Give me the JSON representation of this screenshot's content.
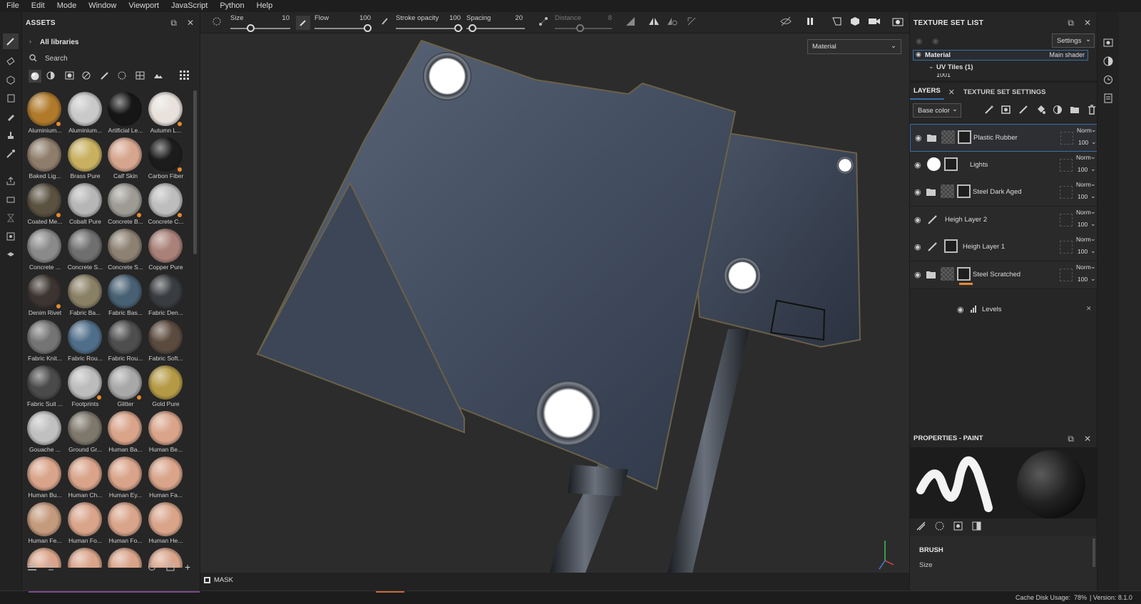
{
  "menu": [
    "File",
    "Edit",
    "Mode",
    "Window",
    "Viewport",
    "JavaScript",
    "Python",
    "Help"
  ],
  "assets": {
    "title": "ASSETS",
    "breadcrumb": "All libraries",
    "search_placeholder": "Search",
    "items": [
      {
        "label": "Aluminium...",
        "color": "#b07a2a",
        "mark": true
      },
      {
        "label": "Aluminium...",
        "color": "#c9c9c9",
        "mark": false
      },
      {
        "label": "Artificial Le...",
        "color": "#161616",
        "mark": false
      },
      {
        "label": "Autumn L...",
        "color": "#e8e1dc",
        "mark": true
      },
      {
        "label": "Baked Lig...",
        "color": "#8e7d6b",
        "mark": false
      },
      {
        "label": "Brass Pure",
        "color": "#c8b060",
        "mark": false
      },
      {
        "label": "Calf Skin",
        "color": "#d6a58e",
        "mark": false
      },
      {
        "label": "Carbon Fiber",
        "color": "#1c1c1c",
        "mark": true
      },
      {
        "label": "Coated Me...",
        "color": "#5a5140",
        "mark": true
      },
      {
        "label": "Cobalt Pure",
        "color": "#b6b6b6",
        "mark": false
      },
      {
        "label": "Concrete B...",
        "color": "#9e9b95",
        "mark": true
      },
      {
        "label": "Concrete C...",
        "color": "#bdbdbd",
        "mark": true
      },
      {
        "label": "Concrete ...",
        "color": "#8a8a8a",
        "mark": false
      },
      {
        "label": "Concrete S...",
        "color": "#6f6f6f",
        "mark": false
      },
      {
        "label": "Concrete S...",
        "color": "#8c8172",
        "mark": false
      },
      {
        "label": "Copper Pure",
        "color": "#a98178",
        "mark": false
      },
      {
        "label": "Denim Rivet",
        "color": "#3c3430",
        "mark": true
      },
      {
        "label": "Fabric Ba...",
        "color": "#8a8066",
        "mark": false
      },
      {
        "label": "Fabric Bas...",
        "color": "#476073",
        "mark": false
      },
      {
        "label": "Fabric Den...",
        "color": "#393c40",
        "mark": false
      },
      {
        "label": "Fabric Knit...",
        "color": "#747474",
        "mark": false
      },
      {
        "label": "Fabric Rou...",
        "color": "#4f6e8a",
        "mark": false
      },
      {
        "label": "Fabric Rou...",
        "color": "#4e4e4e",
        "mark": false
      },
      {
        "label": "Fabric Soft...",
        "color": "#5b4a3e",
        "mark": false
      },
      {
        "label": "Fabric Suit ...",
        "color": "#4a4a4a",
        "mark": false
      },
      {
        "label": "Footprints",
        "color": "#bcbcbc",
        "mark": true
      },
      {
        "label": "Glitter",
        "color": "#a8a8a8",
        "mark": true
      },
      {
        "label": "Gold Pure",
        "color": "#b59a45",
        "mark": false
      },
      {
        "label": "Gouache ...",
        "color": "#c0c0c0",
        "mark": false
      },
      {
        "label": "Ground Gr...",
        "color": "#7e786c",
        "mark": false
      },
      {
        "label": "Human Ba...",
        "color": "#d9a48a",
        "mark": false
      },
      {
        "label": "Human Be...",
        "color": "#d9a48a",
        "mark": false
      },
      {
        "label": "Human Bu...",
        "color": "#d9a48a",
        "mark": false
      },
      {
        "label": "Human Ch...",
        "color": "#d9a48a",
        "mark": false
      },
      {
        "label": "Human Ey...",
        "color": "#d9a48a",
        "mark": false
      },
      {
        "label": "Human Fa...",
        "color": "#d9a48a",
        "mark": false
      },
      {
        "label": "Human Fe...",
        "color": "#c49a7c",
        "mark": false
      },
      {
        "label": "Human Fo...",
        "color": "#d9a48a",
        "mark": false
      },
      {
        "label": "Human Fo...",
        "color": "#d9a48a",
        "mark": false
      },
      {
        "label": "Human He...",
        "color": "#d9a48a",
        "mark": false
      },
      {
        "label": "",
        "color": "#d9a48a",
        "mark": false
      },
      {
        "label": "",
        "color": "#d9a48a",
        "mark": false
      },
      {
        "label": "",
        "color": "#d9a48a",
        "mark": false
      },
      {
        "label": "",
        "color": "#d9a48a",
        "mark": false
      }
    ]
  },
  "toolbar": {
    "size_label": "Size",
    "size_value": "10",
    "flow_label": "Flow",
    "flow_value": "100",
    "stroke_label": "Stroke opacity",
    "stroke_value": "100",
    "spacing_label": "Spacing",
    "spacing_value": "20",
    "distance_label": "Distance",
    "distance_value": "8"
  },
  "viewport": {
    "mode_select": "Material",
    "mask_label": "MASK"
  },
  "texture_set_list": {
    "title": "TEXTURE SET LIST",
    "settings": "Settings",
    "material": "Material",
    "shader": "Main shader",
    "uv_tiles": "UV Tiles (1)",
    "tile": "1001"
  },
  "layers_panel": {
    "tab_layers": "LAYERS",
    "tab_tss": "TEXTURE SET SETTINGS",
    "channel": "Base color",
    "layers": [
      {
        "name": "Plastic Rubber",
        "blend": "Norm",
        "opacity": "100",
        "type": "folder",
        "selected": true
      },
      {
        "name": "Lights",
        "blend": "Norm",
        "opacity": "100",
        "type": "fill-white",
        "selected": false
      },
      {
        "name": "Steel Dark Aged",
        "blend": "Norm",
        "opacity": "100",
        "type": "folder",
        "selected": false
      },
      {
        "name": "Heigh Layer 2",
        "blend": "Norm",
        "opacity": "100",
        "type": "paint",
        "selected": false
      },
      {
        "name": "Heigh Layer 1",
        "blend": "Norm",
        "opacity": "100",
        "type": "paint-mask",
        "selected": false
      },
      {
        "name": "Steel Scratched",
        "blend": "Norm",
        "opacity": "100",
        "type": "folder",
        "selected": false
      }
    ],
    "effect": "Levels"
  },
  "properties": {
    "title": "PROPERTIES - PAINT",
    "section": "BRUSH",
    "field": "Size"
  },
  "status": {
    "cache": "Cache Disk Usage:",
    "cache_value": "78%",
    "version": "| Version: 8.1.0"
  },
  "colors": {
    "selection": "#3a6ea5",
    "accent": "#e88a2e",
    "panel": "#262626",
    "viewport": "#2c2c2c"
  }
}
